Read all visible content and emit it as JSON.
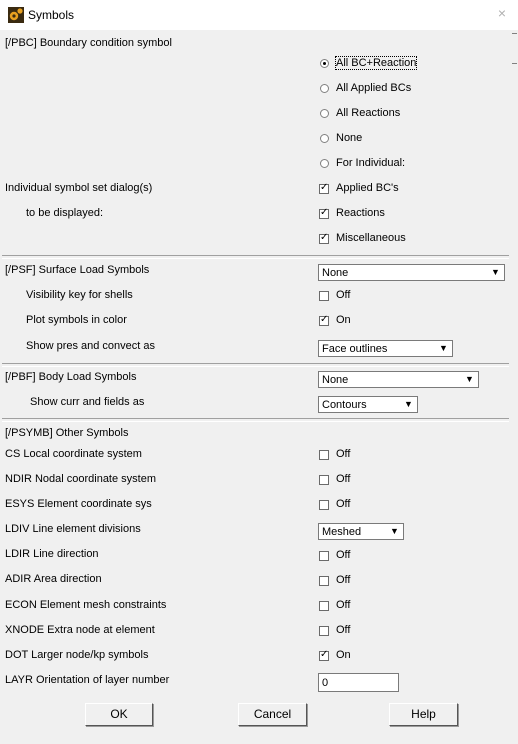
{
  "window": {
    "title": "Symbols",
    "close_glyph": "×"
  },
  "pbc": {
    "header": "[/PBC] Boundary condition symbol",
    "options": [
      {
        "label": "All BC+Reaction",
        "checked": true
      },
      {
        "label": "All Applied BCs",
        "checked": false
      },
      {
        "label": "All Reactions",
        "checked": false
      },
      {
        "label": "None",
        "checked": false
      },
      {
        "label": "For Individual:",
        "checked": false
      }
    ],
    "individual_label_1": "Individual symbol set dialog(s)",
    "individual_label_2": "to be displayed:",
    "individual": [
      {
        "label": "Applied BC's",
        "checked": true
      },
      {
        "label": "Reactions",
        "checked": true
      },
      {
        "label": "Miscellaneous",
        "checked": true
      }
    ]
  },
  "psf": {
    "header": "[/PSF]  Surface Load Symbols",
    "select_value": "None",
    "visibility_label": "Visibility key for shells",
    "visibility_check": "Off",
    "visibility_checked": false,
    "color_label": "Plot symbols in color",
    "color_check": "On",
    "color_checked": true,
    "pres_label": "Show pres and convect as",
    "pres_value": "Face outlines"
  },
  "pbf": {
    "header": "[/PBF]  Body Load Symbols",
    "select_value": "None",
    "curr_label": "Show curr and fields as",
    "curr_value": "Contours"
  },
  "psymb": {
    "header": "[/PSYMB] Other Symbols",
    "rows": [
      {
        "label": "CS   Local coordinate system",
        "control": "check",
        "text": "Off",
        "checked": false
      },
      {
        "label": "NDIR Nodal coordinate system",
        "control": "check",
        "text": "Off",
        "checked": false
      },
      {
        "label": "ESYS Element coordinate sys",
        "control": "check",
        "text": "Off",
        "checked": false
      },
      {
        "label": "LDIV  Line element divisions",
        "control": "select",
        "text": "Meshed"
      },
      {
        "label": "LDIR Line direction",
        "control": "check",
        "text": "Off",
        "checked": false
      },
      {
        "label": "ADIR Area direction",
        "control": "check",
        "text": "Off",
        "checked": false
      },
      {
        "label": "ECON Element mesh constraints",
        "control": "check",
        "text": "Off",
        "checked": false
      },
      {
        "label": "XNODE Extra node at element",
        "control": "check",
        "text": "Off",
        "checked": false
      },
      {
        "label": "DOT  Larger node/kp symbols",
        "control": "check",
        "text": "On",
        "checked": true
      },
      {
        "label": "LAYR Orientation of layer number",
        "control": "input",
        "text": "0"
      }
    ]
  },
  "buttons": {
    "ok": "OK",
    "cancel": "Cancel",
    "help": "Help"
  },
  "glyphs": {
    "check_mark": "✓",
    "dropdown_arrow": "▼"
  }
}
